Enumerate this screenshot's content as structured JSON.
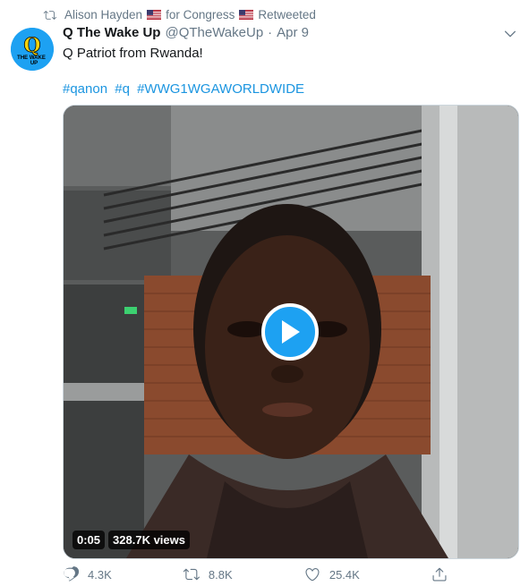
{
  "retweet": {
    "user": "Alison Hayden",
    "party_text": "for Congress",
    "action": "Retweeted"
  },
  "author": {
    "display_name": "Q The Wake Up",
    "handle": "@QTheWakeUp",
    "separator": "·",
    "date": "Apr 9",
    "avatar_letter": "Q",
    "avatar_text": "THE WAKE UP"
  },
  "tweet": {
    "text": "Q Patriot from Rwanda!",
    "hashtags": [
      "#qanon",
      "#q",
      "#WWG1WGAWORLDWIDE"
    ]
  },
  "video": {
    "duration": "0:05",
    "views": "328.7K views"
  },
  "actions": {
    "replies": "4.3K",
    "retweets": "8.8K",
    "likes": "25.4K"
  },
  "colors": {
    "accent": "#1da1f2",
    "link": "#1b95e0",
    "muted": "#657786"
  }
}
